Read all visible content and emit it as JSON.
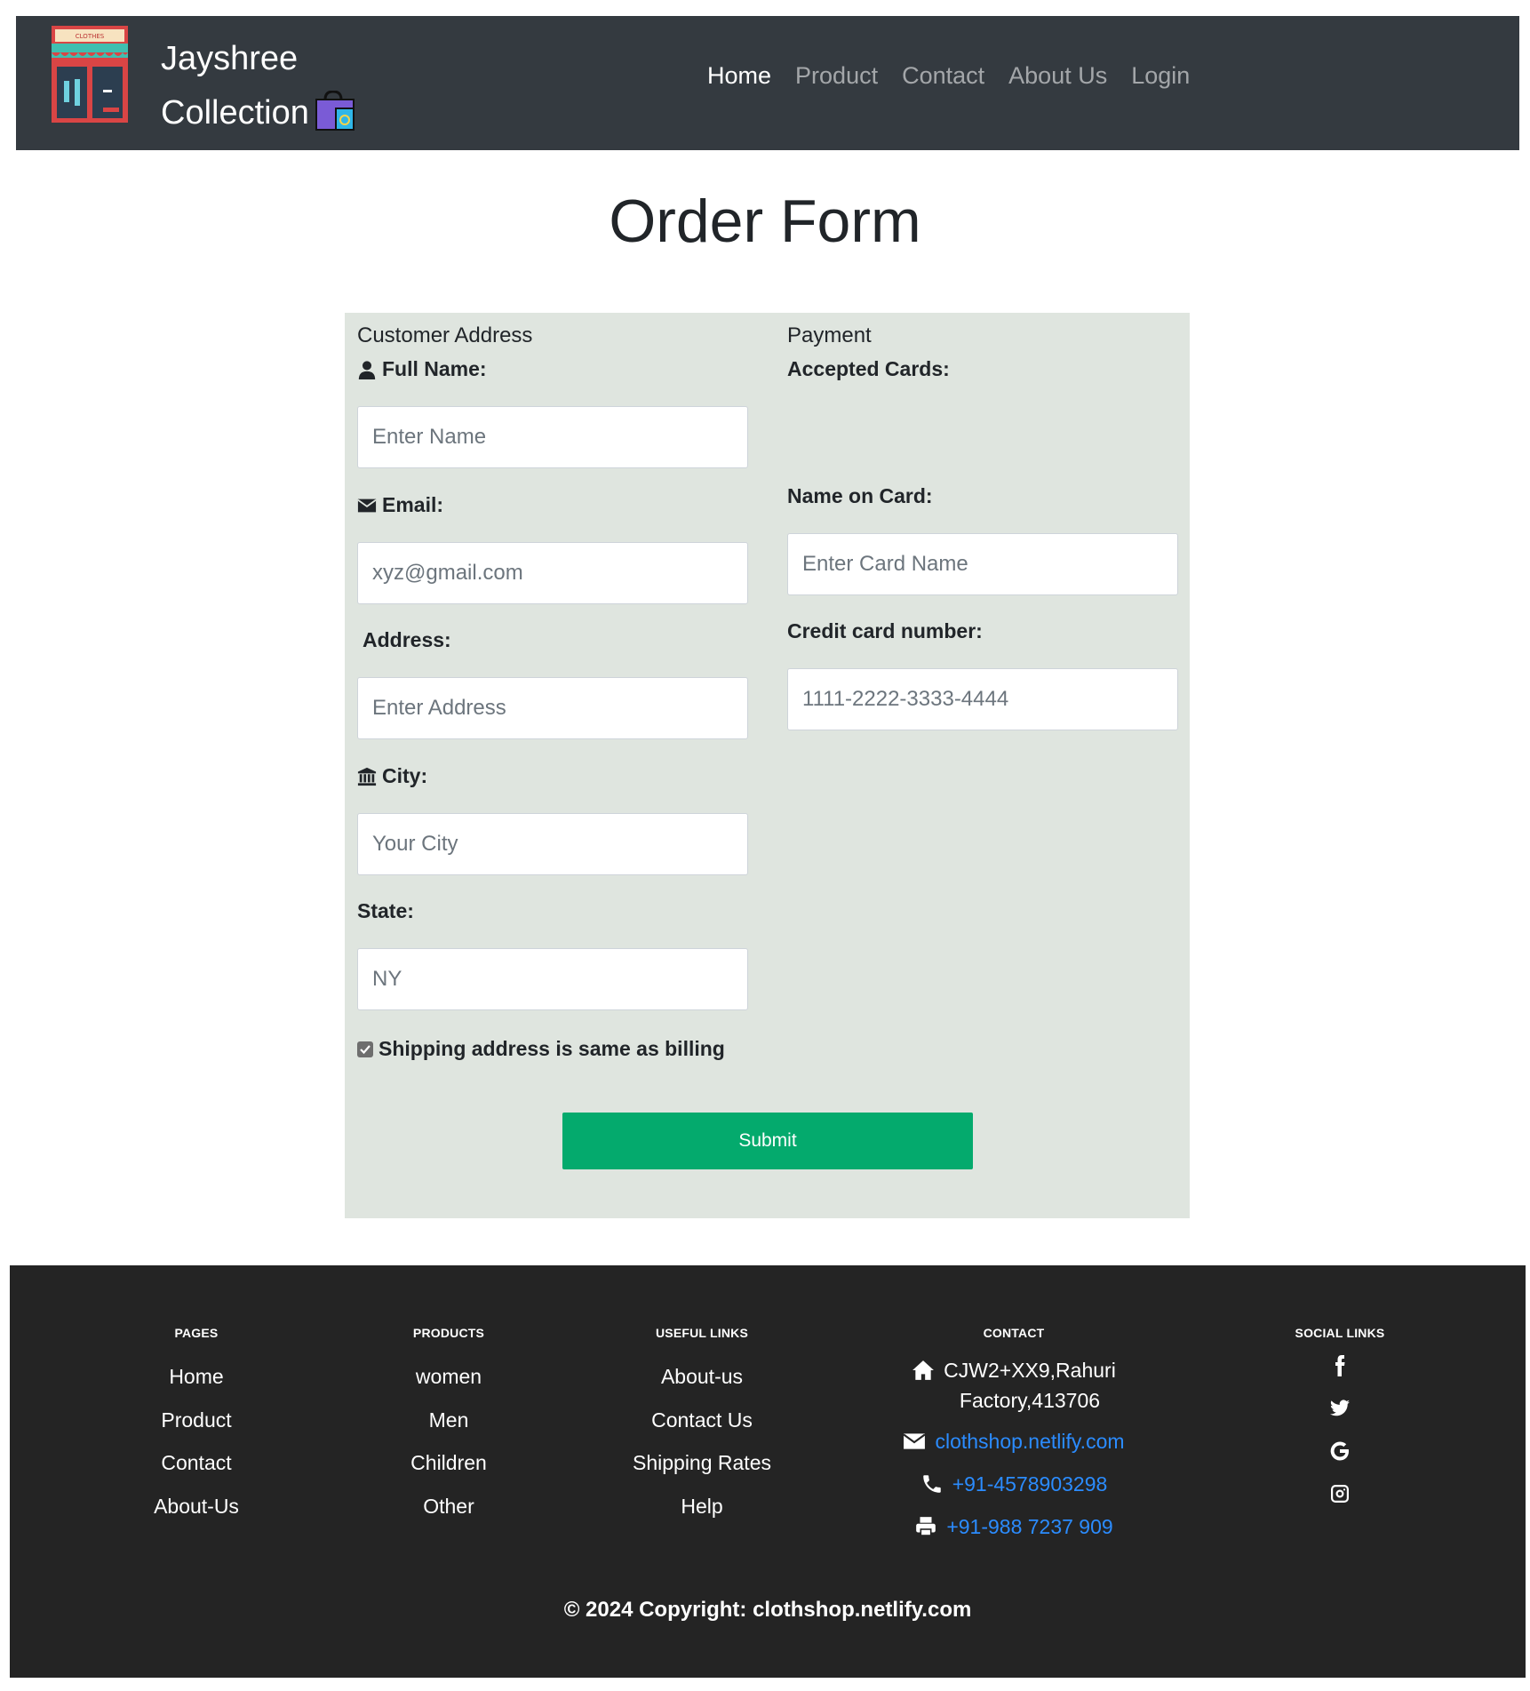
{
  "navbar": {
    "brand_line1": "Jayshree",
    "brand_line2": "Collection",
    "logo_text": "CLOTHES",
    "links": [
      {
        "label": "Home",
        "active": true
      },
      {
        "label": "Product",
        "active": false
      },
      {
        "label": "Contact",
        "active": false
      },
      {
        "label": "About Us",
        "active": false
      },
      {
        "label": "Login",
        "active": false
      }
    ]
  },
  "page": {
    "title": "Order Form"
  },
  "form": {
    "billing": {
      "heading": "Customer Address",
      "full_name_label": "Full Name:",
      "full_name_placeholder": "Enter Name",
      "email_label": "Email:",
      "email_placeholder": "xyz@gmail.com",
      "address_label": "Address:",
      "address_placeholder": "Enter Address",
      "city_label": "City:",
      "city_placeholder": "Your City",
      "state_label": "State:",
      "state_placeholder": "NY",
      "same_address_label": "Shipping address is same as billing",
      "same_address_checked": true
    },
    "payment": {
      "heading": "Payment",
      "accepted_cards_label": "Accepted Cards:",
      "card_name_label": "Name on Card:",
      "card_name_placeholder": "Enter Card Name",
      "card_number_label": "Credit card number:",
      "card_number_placeholder": "1111-2222-3333-4444"
    },
    "submit_label": "Submit"
  },
  "footer": {
    "pages": {
      "heading": "PAGES",
      "items": [
        "Home",
        "Product",
        "Contact",
        "About-Us"
      ]
    },
    "products": {
      "heading": "PRODUCTS",
      "items": [
        "women",
        "Men",
        "Children",
        "Other"
      ]
    },
    "useful_links": {
      "heading": "USEFUL LINKS",
      "items": [
        "About-us",
        "Contact Us",
        "Shipping Rates",
        "Help"
      ]
    },
    "contact": {
      "heading": "CONTACT",
      "address_line1": "CJW2+XX9,Rahuri",
      "address_line2": "Factory,413706",
      "email": "clothshop.netlify.com",
      "phone": "+91-4578903298",
      "fax": "+91-988 7237 909"
    },
    "social": {
      "heading": "SOCIAL LINKS",
      "icons": [
        "facebook-icon",
        "twitter-icon",
        "google-icon",
        "instagram-icon"
      ]
    },
    "copyright": "© 2024 Copyright: clothshop.netlify.com"
  },
  "colors": {
    "navbar_bg": "#343a40",
    "panel_bg": "#dfe5df",
    "submit_bg": "#04aa6d",
    "footer_bg": "#242424",
    "link_blue": "#2b8cff"
  }
}
